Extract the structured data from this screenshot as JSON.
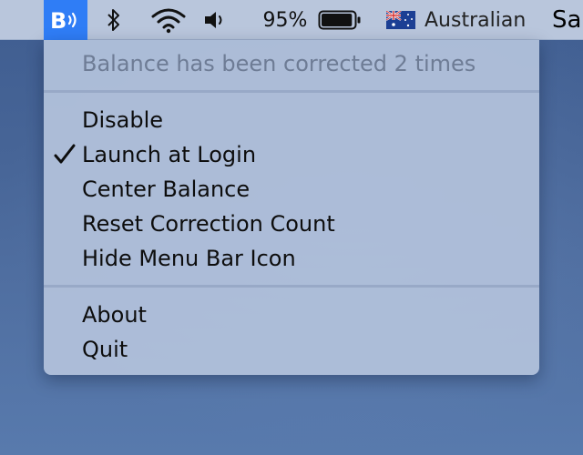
{
  "menubar": {
    "app_icon": "balance-lock-icon",
    "bluetooth_icon": "bluetooth-icon",
    "wifi_icon": "wifi-icon",
    "volume_icon": "volume-icon",
    "battery_percent": "95%",
    "battery_level": 0.95,
    "flag_icon": "australian-flag-icon",
    "input_source": "Australian",
    "truncated_item": "Sa"
  },
  "menu": {
    "status": "Balance has been corrected 2 times",
    "items": [
      {
        "label": "Disable",
        "checked": false
      },
      {
        "label": "Launch at Login",
        "checked": true
      },
      {
        "label": "Center Balance",
        "checked": false
      },
      {
        "label": "Reset Correction Count",
        "checked": false
      },
      {
        "label": "Hide Menu Bar Icon",
        "checked": false
      }
    ],
    "footer_items": [
      {
        "label": "About"
      },
      {
        "label": "Quit"
      }
    ]
  },
  "colors": {
    "app_icon_bg": "#2f7df6",
    "menu_bg": "#b0bfda"
  }
}
